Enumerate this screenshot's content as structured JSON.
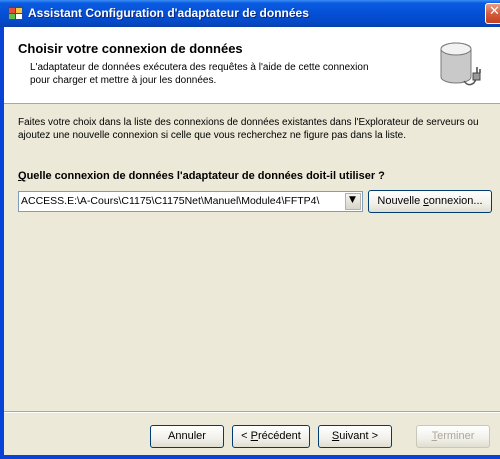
{
  "window": {
    "title": "Assistant Configuration d'adaptateur de données",
    "close_glyph": "✕"
  },
  "header": {
    "title": "Choisir votre connexion de données",
    "subtitle": "L'adaptateur de données exécutera des requêtes à l'aide de cette connexion pour charger et mettre à jour les données.",
    "icon": "database-plug-icon"
  },
  "body": {
    "intro": "Faites votre choix dans la liste des connexions de données existantes dans l'Explorateur de serveurs ou ajoutez une nouvelle connexion si celle que vous recherchez ne figure pas dans la liste.",
    "question_mnemonic": "Q",
    "question_rest": "uelle connexion de données l'adaptateur de données doit-il utiliser ?",
    "connection_value": "ACCESS.E:\\A-Cours\\C1175\\C1175Net\\Manuel\\Module4\\FFTP4\\",
    "new_connection_mnemonic_pre": "Nouvelle ",
    "new_connection_mnemonic": "c",
    "new_connection_rest": "onnexion..."
  },
  "footer": {
    "cancel": "Annuler",
    "prev_pre": "< ",
    "prev_mnemonic": "P",
    "prev_rest": "récédent",
    "next_mnemonic": "S",
    "next_rest": "uivant >",
    "finish_mnemonic": "T",
    "finish_rest": "erminer"
  },
  "colors": {
    "titlebar": "#0450d6",
    "client_bg": "#ece9d8",
    "header_bg": "#ffffff",
    "close_bg": "#d65c3d"
  }
}
